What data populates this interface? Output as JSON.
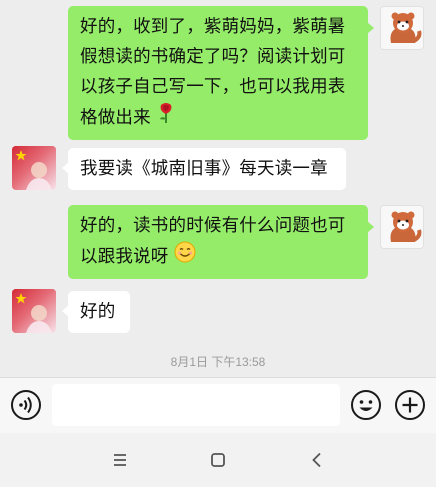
{
  "messages": [
    {
      "from": "me",
      "text": "好的，收到了，紫萌妈妈，紫萌暑假想读的书确定了吗？阅读计划可以孩子自己写一下，也可以我用表格做出来",
      "emoji": "rose-icon"
    },
    {
      "from": "other",
      "text": "我要读《城南旧事》每天读一章"
    },
    {
      "from": "me",
      "text": "好的，读书的时候有什么问题也可以跟我说呀",
      "emoji": "smile-icon"
    },
    {
      "from": "other",
      "text": "好的"
    }
  ],
  "timestamp": "8月1日 下午13:58",
  "input": {
    "value": "",
    "placeholder": ""
  },
  "icons": {
    "voice": "voice-icon",
    "emoji": "emoji-icon",
    "more": "plus-icon",
    "nav_menu": "menu-icon",
    "nav_home": "home-icon",
    "nav_back": "back-icon"
  },
  "colors": {
    "my_bubble": "#95ec69",
    "their_bubble": "#ffffff",
    "chat_bg": "#ededed"
  }
}
